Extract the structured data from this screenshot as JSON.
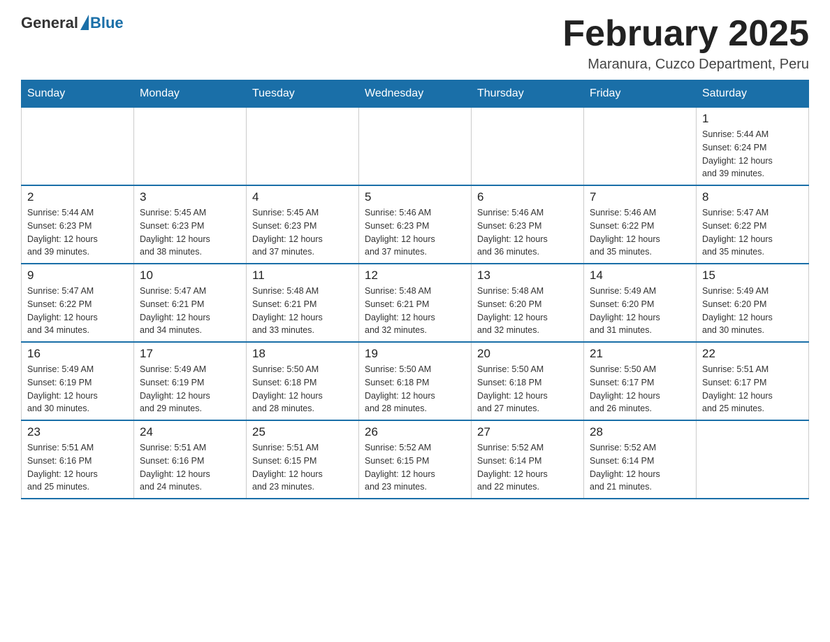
{
  "header": {
    "logo_general": "General",
    "logo_blue": "Blue",
    "month_title": "February 2025",
    "location": "Maranura, Cuzco Department, Peru"
  },
  "days_of_week": [
    "Sunday",
    "Monday",
    "Tuesday",
    "Wednesday",
    "Thursday",
    "Friday",
    "Saturday"
  ],
  "weeks": [
    [
      {
        "day": "",
        "info": ""
      },
      {
        "day": "",
        "info": ""
      },
      {
        "day": "",
        "info": ""
      },
      {
        "day": "",
        "info": ""
      },
      {
        "day": "",
        "info": ""
      },
      {
        "day": "",
        "info": ""
      },
      {
        "day": "1",
        "info": "Sunrise: 5:44 AM\nSunset: 6:24 PM\nDaylight: 12 hours\nand 39 minutes."
      }
    ],
    [
      {
        "day": "2",
        "info": "Sunrise: 5:44 AM\nSunset: 6:23 PM\nDaylight: 12 hours\nand 39 minutes."
      },
      {
        "day": "3",
        "info": "Sunrise: 5:45 AM\nSunset: 6:23 PM\nDaylight: 12 hours\nand 38 minutes."
      },
      {
        "day": "4",
        "info": "Sunrise: 5:45 AM\nSunset: 6:23 PM\nDaylight: 12 hours\nand 37 minutes."
      },
      {
        "day": "5",
        "info": "Sunrise: 5:46 AM\nSunset: 6:23 PM\nDaylight: 12 hours\nand 37 minutes."
      },
      {
        "day": "6",
        "info": "Sunrise: 5:46 AM\nSunset: 6:23 PM\nDaylight: 12 hours\nand 36 minutes."
      },
      {
        "day": "7",
        "info": "Sunrise: 5:46 AM\nSunset: 6:22 PM\nDaylight: 12 hours\nand 35 minutes."
      },
      {
        "day": "8",
        "info": "Sunrise: 5:47 AM\nSunset: 6:22 PM\nDaylight: 12 hours\nand 35 minutes."
      }
    ],
    [
      {
        "day": "9",
        "info": "Sunrise: 5:47 AM\nSunset: 6:22 PM\nDaylight: 12 hours\nand 34 minutes."
      },
      {
        "day": "10",
        "info": "Sunrise: 5:47 AM\nSunset: 6:21 PM\nDaylight: 12 hours\nand 34 minutes."
      },
      {
        "day": "11",
        "info": "Sunrise: 5:48 AM\nSunset: 6:21 PM\nDaylight: 12 hours\nand 33 minutes."
      },
      {
        "day": "12",
        "info": "Sunrise: 5:48 AM\nSunset: 6:21 PM\nDaylight: 12 hours\nand 32 minutes."
      },
      {
        "day": "13",
        "info": "Sunrise: 5:48 AM\nSunset: 6:20 PM\nDaylight: 12 hours\nand 32 minutes."
      },
      {
        "day": "14",
        "info": "Sunrise: 5:49 AM\nSunset: 6:20 PM\nDaylight: 12 hours\nand 31 minutes."
      },
      {
        "day": "15",
        "info": "Sunrise: 5:49 AM\nSunset: 6:20 PM\nDaylight: 12 hours\nand 30 minutes."
      }
    ],
    [
      {
        "day": "16",
        "info": "Sunrise: 5:49 AM\nSunset: 6:19 PM\nDaylight: 12 hours\nand 30 minutes."
      },
      {
        "day": "17",
        "info": "Sunrise: 5:49 AM\nSunset: 6:19 PM\nDaylight: 12 hours\nand 29 minutes."
      },
      {
        "day": "18",
        "info": "Sunrise: 5:50 AM\nSunset: 6:18 PM\nDaylight: 12 hours\nand 28 minutes."
      },
      {
        "day": "19",
        "info": "Sunrise: 5:50 AM\nSunset: 6:18 PM\nDaylight: 12 hours\nand 28 minutes."
      },
      {
        "day": "20",
        "info": "Sunrise: 5:50 AM\nSunset: 6:18 PM\nDaylight: 12 hours\nand 27 minutes."
      },
      {
        "day": "21",
        "info": "Sunrise: 5:50 AM\nSunset: 6:17 PM\nDaylight: 12 hours\nand 26 minutes."
      },
      {
        "day": "22",
        "info": "Sunrise: 5:51 AM\nSunset: 6:17 PM\nDaylight: 12 hours\nand 25 minutes."
      }
    ],
    [
      {
        "day": "23",
        "info": "Sunrise: 5:51 AM\nSunset: 6:16 PM\nDaylight: 12 hours\nand 25 minutes."
      },
      {
        "day": "24",
        "info": "Sunrise: 5:51 AM\nSunset: 6:16 PM\nDaylight: 12 hours\nand 24 minutes."
      },
      {
        "day": "25",
        "info": "Sunrise: 5:51 AM\nSunset: 6:15 PM\nDaylight: 12 hours\nand 23 minutes."
      },
      {
        "day": "26",
        "info": "Sunrise: 5:52 AM\nSunset: 6:15 PM\nDaylight: 12 hours\nand 23 minutes."
      },
      {
        "day": "27",
        "info": "Sunrise: 5:52 AM\nSunset: 6:14 PM\nDaylight: 12 hours\nand 22 minutes."
      },
      {
        "day": "28",
        "info": "Sunrise: 5:52 AM\nSunset: 6:14 PM\nDaylight: 12 hours\nand 21 minutes."
      },
      {
        "day": "",
        "info": ""
      }
    ]
  ]
}
